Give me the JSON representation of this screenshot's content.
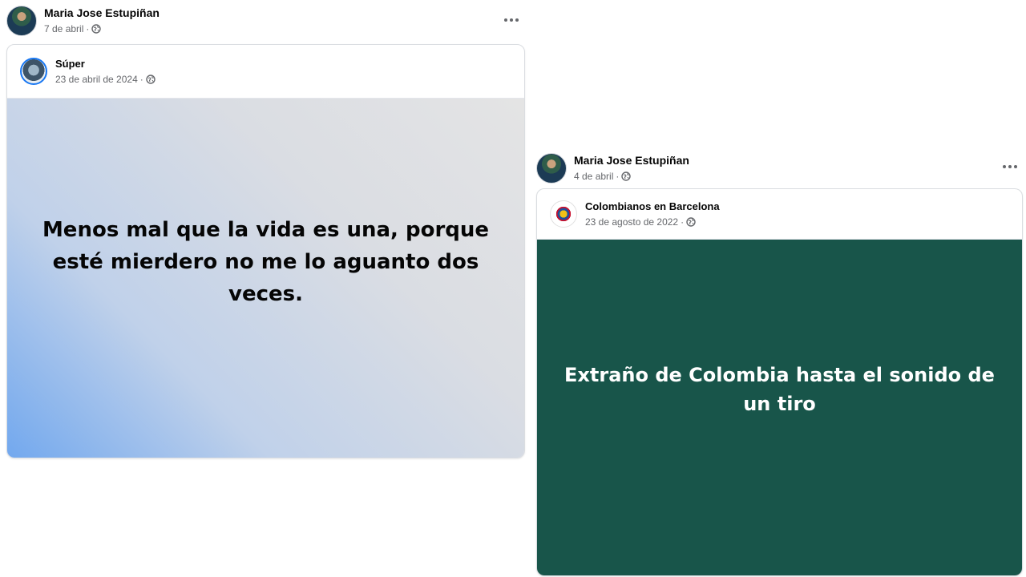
{
  "posts": [
    {
      "author": "Maria Jose Estupiñan",
      "date": "7 de abril",
      "separator": "·",
      "shared": {
        "page_name": "Súper",
        "date": "23 de abril de 2024",
        "separator": "·",
        "text": "Menos mal que la vida es una, porque esté mierdero no me lo aguanto dos veces.",
        "background": "gradient-blue-gray"
      }
    },
    {
      "author": "Maria Jose Estupiñan",
      "date": "4 de abril",
      "separator": "·",
      "shared": {
        "page_name": "Colombianos en Barcelona",
        "date": "23 de agosto de 2022",
        "separator": "·",
        "text": "Extraño de Colombia hasta el sonido de un tiro",
        "background": "#18554a"
      }
    }
  ],
  "icons": {
    "privacy": "globe-icon",
    "menu": "more-options-icon"
  },
  "colors": {
    "meta_text": "#65676b",
    "green_background": "#18554a",
    "gradient_blue": "#72a8ee",
    "gradient_gray": "#e4e4e4"
  }
}
